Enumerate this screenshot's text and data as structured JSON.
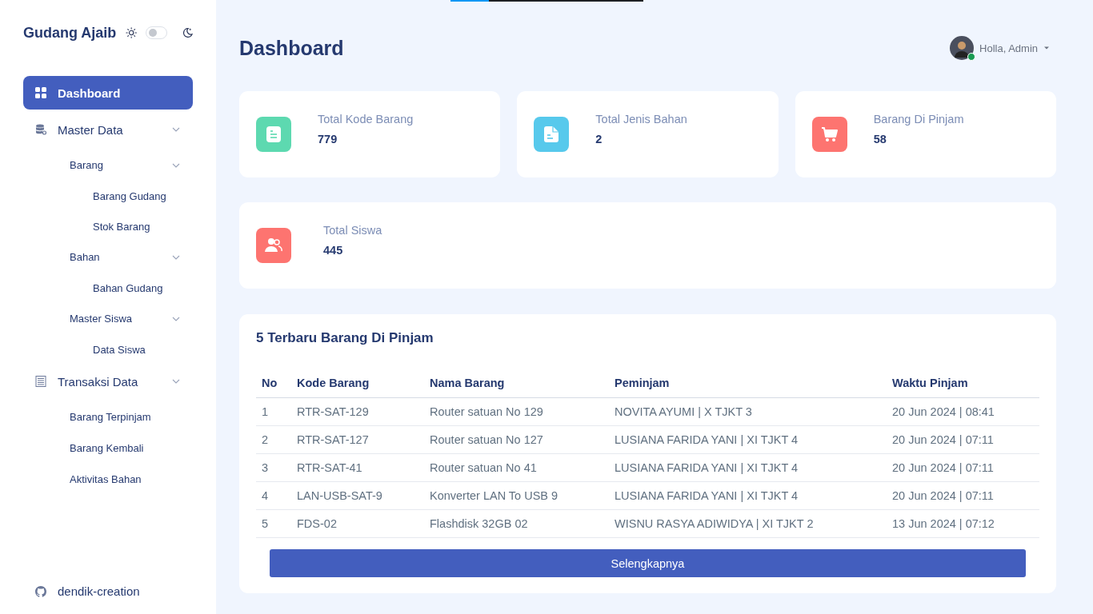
{
  "loading_bar": {
    "level": 0.2
  },
  "sidebar": {
    "brand": "Gudang Ajaib",
    "dark_mode": {
      "on": false
    },
    "items": [
      {
        "label": "Dashboard",
        "kind": "grid",
        "selected": true
      },
      {
        "label": "Master Data",
        "kind": "database",
        "selected": false,
        "expanded": true,
        "children": [
          {
            "label": "Barang",
            "selected": false,
            "expanded": true,
            "children": [
              {
                "label": "Barang Gudang",
                "selected": false
              },
              {
                "label": "Stok Barang",
                "selected": false
              }
            ]
          },
          {
            "label": "Bahan",
            "selected": false,
            "expanded": true,
            "children": [
              {
                "label": "Bahan Gudang",
                "selected": false
              }
            ]
          },
          {
            "label": "Master Siswa",
            "selected": false,
            "expanded": true,
            "children": [
              {
                "label": "Data Siswa",
                "selected": false
              }
            ]
          }
        ]
      },
      {
        "label": "Transaksi Data",
        "kind": "list",
        "selected": false,
        "expanded": true,
        "children": [
          {
            "label": "Barang Terpinjam",
            "selected": false
          },
          {
            "label": "Barang Kembali",
            "selected": false
          },
          {
            "label": "Aktivitas Bahan",
            "selected": false
          }
        ]
      }
    ],
    "footer_link": "dendik-creation"
  },
  "header": {
    "title": "Dashboard",
    "user": {
      "greeting": "Holla, Admin",
      "online": true
    }
  },
  "stats": [
    {
      "label": "Total Kode Barang",
      "value": "779",
      "kind": "document",
      "color": "#5dd9b0"
    },
    {
      "label": "Total Jenis Bahan",
      "value": "2",
      "kind": "file",
      "color": "#57c9ec"
    },
    {
      "label": "Barang Di Pinjam",
      "value": "58",
      "kind": "cart",
      "color": "#fd7470"
    },
    {
      "label": "Total Siswa",
      "value": "445",
      "kind": "users",
      "color": "#fd7470"
    }
  ],
  "table": {
    "title": "5 Terbaru Barang Di Pinjam",
    "columns": [
      "No",
      "Kode Barang",
      "Nama Barang",
      "Peminjam",
      "Waktu Pinjam"
    ],
    "rows": [
      [
        "1",
        "RTR-SAT-129",
        "Router satuan No 129",
        "NOVITA AYUMI | X TJKT 3",
        "20 Jun 2024 | 08:41"
      ],
      [
        "2",
        "RTR-SAT-127",
        "Router satuan No 127",
        "LUSIANA FARIDA YANI | XI TJKT 4",
        "20 Jun 2024 | 07:11"
      ],
      [
        "3",
        "RTR-SAT-41",
        "Router satuan No 41",
        "LUSIANA FARIDA YANI | XI TJKT 4",
        "20 Jun 2024 | 07:11"
      ],
      [
        "4",
        "LAN-USB-SAT-9",
        "Konverter LAN To USB 9",
        "LUSIANA FARIDA YANI | XI TJKT 4",
        "20 Jun 2024 | 07:11"
      ],
      [
        "5",
        "FDS-02",
        "Flashdisk 32GB 02",
        "WISNU RASYA ADIWIDYA | XI TJKT 2",
        "13 Jun 2024 | 07:12"
      ]
    ],
    "button": "Selengkapnya"
  }
}
